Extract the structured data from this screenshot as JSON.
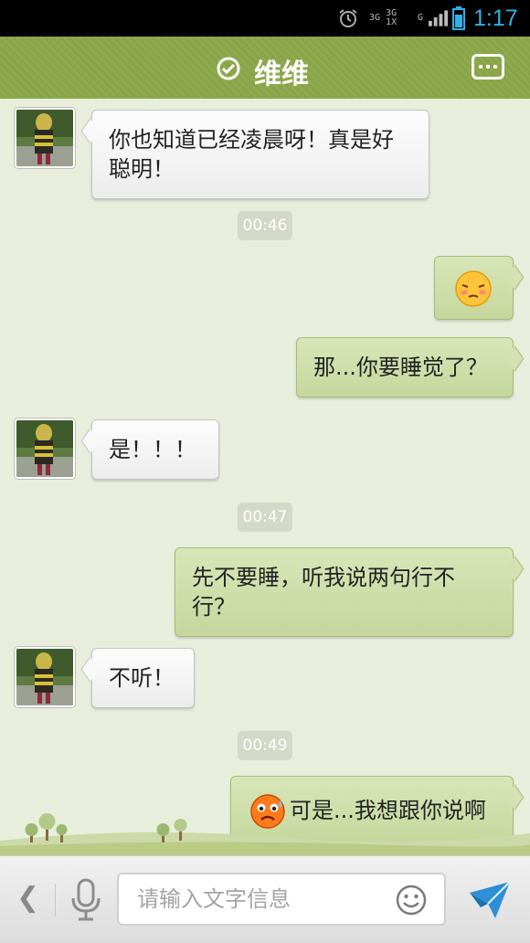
{
  "status_bar": {
    "time": "1:17",
    "network_labels": [
      "3G",
      "3G 1X",
      "G"
    ]
  },
  "header": {
    "title": "维维",
    "check_icon": "check-circle-icon",
    "menu_icon": "menu-dots-icon"
  },
  "messages": [
    {
      "side": "left",
      "text": "你也知道已经凌晨呀！真是好聪明！"
    },
    {
      "timestamp": "00:46"
    },
    {
      "side": "right",
      "emoji": "embarrassed-face-emoji"
    },
    {
      "side": "right",
      "text": "那...你要睡觉了？"
    },
    {
      "side": "left",
      "text": "是！！！"
    },
    {
      "timestamp": "00:47"
    },
    {
      "side": "right",
      "text": "先不要睡，听我说两句行不行？"
    },
    {
      "side": "left",
      "text": "不听！"
    },
    {
      "timestamp": "00:49"
    },
    {
      "side": "right",
      "emoji": "sweating-face-emoji",
      "text": "可是...我想跟你说啊"
    }
  ],
  "input_bar": {
    "placeholder": "请输入文字信息",
    "back_icon": "back-arrow-icon",
    "voice_icon": "microphone-icon",
    "emoji_icon": "smiley-icon",
    "send_icon": "send-icon"
  },
  "colors": {
    "header": "#8aa547",
    "chat_background": "#e8eedb",
    "right_bubble": "#cddfa7",
    "left_bubble": "#f6f6f6",
    "status_time": "#2fb2e8"
  }
}
